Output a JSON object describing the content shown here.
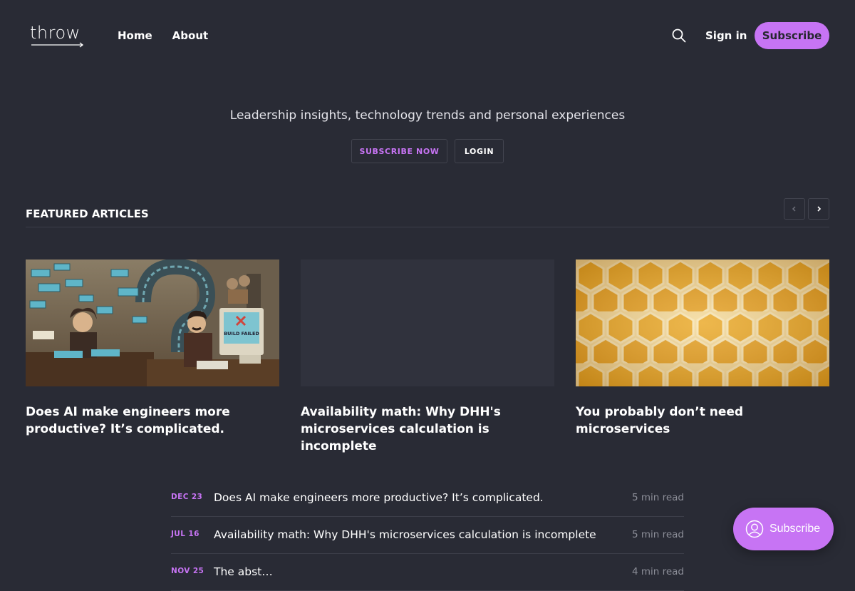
{
  "header": {
    "logo_text": "throw",
    "nav": [
      {
        "label": "Home"
      },
      {
        "label": "About"
      }
    ],
    "search_icon": "search-icon",
    "signin_label": "Sign in",
    "subscribe_label": "Subscribe",
    "accent_color": "#c774f4"
  },
  "hero": {
    "tagline": "Leadership insights, technology trends and personal experiences",
    "subscribe_now_label": "SUBSCRIBE NOW",
    "login_label": "LOGIN"
  },
  "featured": {
    "title": "FEATURED ARTICLES",
    "prev_icon": "chevron-left-icon",
    "next_icon": "chevron-right-icon",
    "cards": [
      {
        "title": "Does AI make engineers more productive? It’s complicated.",
        "image": "illustration of engineers at computers with BUILD FAILED screen",
        "image_caption": "BUILD FAILED"
      },
      {
        "title": "Availability math: Why DHH's microservices calculation is incomplete",
        "image": "blank placeholder"
      },
      {
        "title": "You probably don’t need microservices",
        "image": "honeycomb photo"
      }
    ]
  },
  "posts": [
    {
      "date": "DEC 23",
      "title": "Does AI make engineers more productive? It’s complicated.",
      "read_time": "5 min read"
    },
    {
      "date": "JUL 16",
      "title": "Availability math: Why DHH's microservices calculation is incomplete",
      "read_time": "5 min read"
    },
    {
      "date": "NOV 25",
      "title": "The abst…",
      "read_time": "4 min read"
    }
  ],
  "portal": {
    "label": "Subscribe",
    "icon": "user-icon"
  }
}
